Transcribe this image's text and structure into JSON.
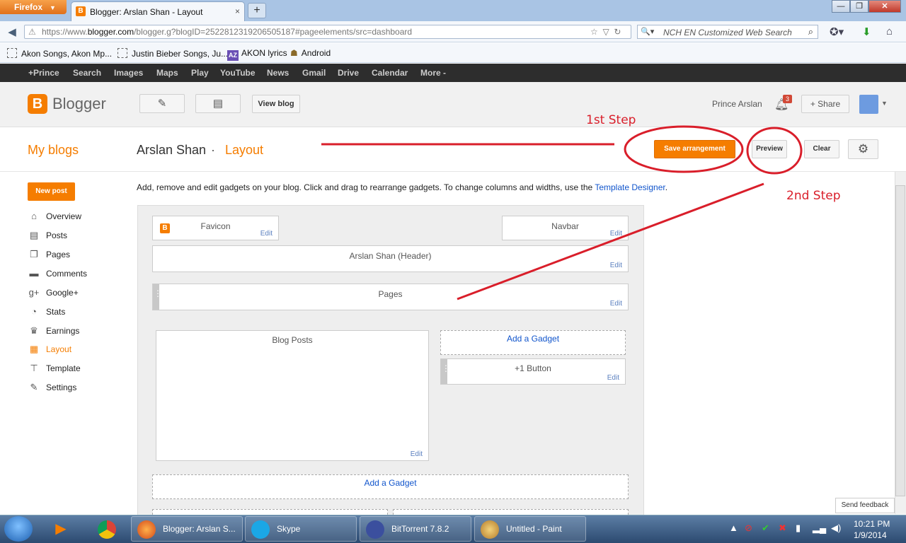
{
  "firefox": {
    "menu_label": "Firefox",
    "tab_title": "Blogger: Arslan Shan - Layout",
    "url_prefix": "https://www.",
    "url_domain": "blogger.com",
    "url_rest": "/blogger.g?blogID=2522812319206505187#pageelements/src=dashboard",
    "search_placeholder": "NCH EN Customized Web Search",
    "bookmarks": [
      "Akon Songs, Akon Mp...",
      "Justin Bieber Songs, Ju...",
      "AKON lyrics",
      "Android"
    ],
    "az_badge": "AZ"
  },
  "google_bar": {
    "items": [
      "+Prince",
      "Search",
      "Images",
      "Maps",
      "Play",
      "YouTube",
      "News",
      "Gmail",
      "Drive",
      "Calendar",
      "More -"
    ]
  },
  "header": {
    "logo_letter": "B",
    "logo_text": "Blogger",
    "view_blog": "View blog",
    "user_name": "Prince Arslan",
    "notif_count": "3",
    "share": "+ Share"
  },
  "titlebar": {
    "my_blogs": "My blogs",
    "blog_name": "Arslan Shan",
    "separator": "·",
    "page": "Layout",
    "save": "Save arrangement",
    "preview": "Preview",
    "clear": "Clear"
  },
  "sidebar": {
    "new_post": "New post",
    "items": [
      {
        "label": "Overview",
        "icon": "home-icon",
        "glyph": "⌂"
      },
      {
        "label": "Posts",
        "icon": "posts-icon",
        "glyph": "▤"
      },
      {
        "label": "Pages",
        "icon": "pages-icon",
        "glyph": "❐"
      },
      {
        "label": "Comments",
        "icon": "comments-icon",
        "glyph": "▬"
      },
      {
        "label": "Google+",
        "icon": "googleplus-icon",
        "glyph": "g+"
      },
      {
        "label": "Stats",
        "icon": "stats-icon",
        "glyph": "◔"
      },
      {
        "label": "Earnings",
        "icon": "trophy-icon",
        "glyph": "♛"
      },
      {
        "label": "Layout",
        "icon": "layout-icon",
        "glyph": "▦"
      },
      {
        "label": "Template",
        "icon": "template-icon",
        "glyph": "⊤"
      },
      {
        "label": "Settings",
        "icon": "wrench-icon",
        "glyph": "✎"
      }
    ],
    "active": "Layout"
  },
  "main": {
    "intro": "Add, remove and edit gadgets on your blog. Click and drag to rearrange gadgets. To change columns and widths, use the ",
    "intro_link": "Template Designer",
    "intro_end": ".",
    "edit": "Edit",
    "gadgets": {
      "favicon": "Favicon",
      "navbar": "Navbar",
      "header": "Arslan Shan (Header)",
      "pages": "Pages",
      "blog_posts": "Blog Posts",
      "add_gadget": "Add a Gadget",
      "plus_one": "+1 Button"
    },
    "send_feedback": "Send feedback"
  },
  "annotations": {
    "step1": "1st Step",
    "step2": "2nd Step",
    "color": "#d91e2a"
  },
  "taskbar": {
    "tasks": [
      "Blogger: Arslan S...",
      "Skype",
      "BitTorrent 7.8.2",
      "Untitled - Paint"
    ],
    "time": "10:21 PM",
    "date": "1/9/2014"
  },
  "colors": {
    "blogger_orange": "#f57d00",
    "link_blue": "#1155cc"
  }
}
